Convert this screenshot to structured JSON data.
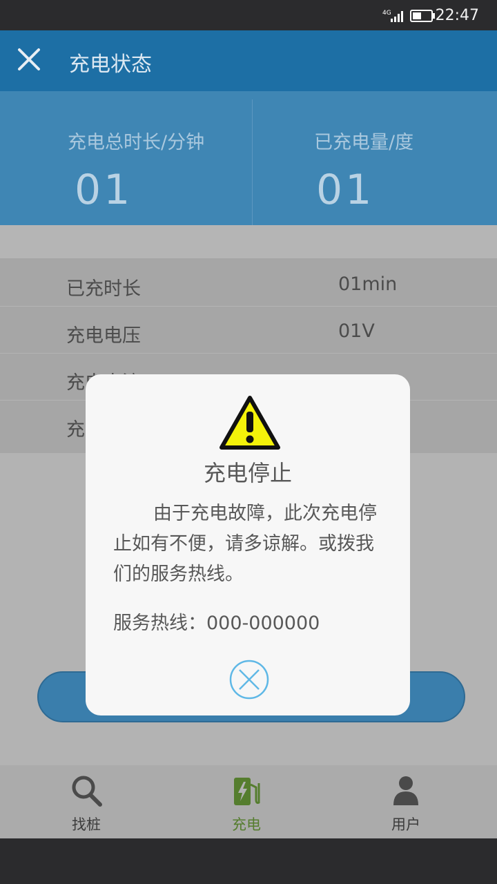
{
  "status_bar": {
    "network": "4G",
    "time": "22:47"
  },
  "app_bar": {
    "title": "充电状态",
    "close_icon": "close-icon"
  },
  "stats": {
    "duration": {
      "label": "充电总时长/分钟",
      "value": "01"
    },
    "energy": {
      "label": "已充电量/度",
      "value": "01"
    }
  },
  "details": [
    {
      "label": "已充时长",
      "value": "01min"
    },
    {
      "label": "充电电压",
      "value": "01V"
    },
    {
      "label": "充电电流",
      "value": ""
    },
    {
      "label": "充",
      "value": ""
    }
  ],
  "dialog": {
    "icon": "warning-icon",
    "title": "充电停止",
    "message": "由于充电故障，此次充电停止如有不便，请多谅解。或拨我们的服务热线。",
    "hotline": "服务热线：000-000000",
    "close_icon": "circle-close-icon"
  },
  "tab_bar": {
    "tabs": [
      {
        "label": "找桩",
        "icon": "search-icon"
      },
      {
        "label": "充电",
        "icon": "charging-station-icon",
        "active": true
      },
      {
        "label": "用户",
        "icon": "user-icon"
      }
    ]
  },
  "colors": {
    "app_bar": "#1d6fa5",
    "stats_panel": "#3f86b4",
    "active_tab": "#557d2e",
    "warning_yellow": "#f4f20a"
  }
}
